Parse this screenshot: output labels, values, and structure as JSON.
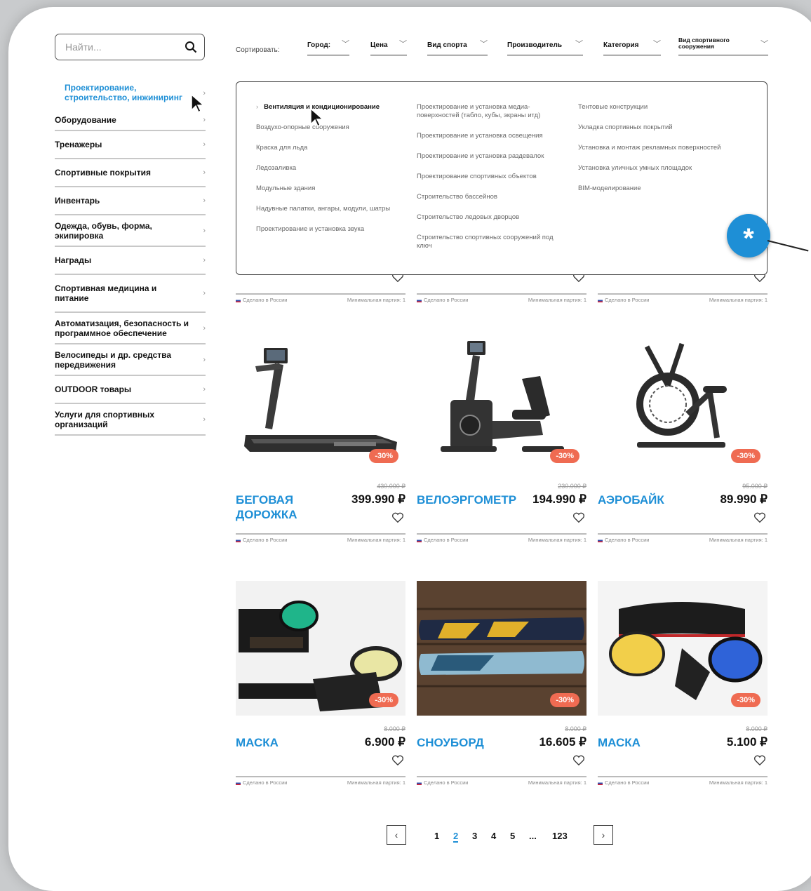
{
  "search": {
    "placeholder": "Найти..."
  },
  "sidebar": {
    "items": [
      {
        "label": "Проектирование, строительство, инжиниринг",
        "active": true
      },
      {
        "label": "Оборудование"
      },
      {
        "label": "Тренажеры"
      },
      {
        "label": "Спортивные покрытия"
      },
      {
        "label": "Инвентарь"
      },
      {
        "label": "Одежда, обувь, форма, экипировка"
      },
      {
        "label": "Награды"
      },
      {
        "label": "Спортивная медицина и питание"
      },
      {
        "label": "Автоматизация, безопасность и программное обеспечение"
      },
      {
        "label": "Велосипеды и др. средства передвижения"
      },
      {
        "label": "OUTDOOR товары"
      },
      {
        "label": "Услуги для спортивных организаций"
      }
    ]
  },
  "sort": {
    "label": "Сортировать:",
    "filters": [
      "Город:",
      "Цена",
      "Вид спорта",
      "Производитель",
      "Категория",
      "Вид спортивного сооружения"
    ]
  },
  "dropdown": {
    "col1": [
      "Вентиляция и кондиционирование",
      "Воздухо-опорные сооружения",
      "Краска для льда",
      "Ледозаливка",
      "Модульные здания",
      "Надувные палатки, ангары, модули, шатры",
      "Проектирование  и установка звука"
    ],
    "col2": [
      "Проектирование и установка медиа-поверхностей (табло, кубы, экраны итд)",
      "Проектирование и установка освещения",
      "Проектирование и установка раздевалок",
      "Проектирование спортивных объектов",
      "Строительство бассейнов",
      "Строительство ледовых дворцов",
      "Строительство спортивных сооружений под ключ"
    ],
    "col3": [
      "Тентовые конструкции",
      "Укладка спортивных покрытий",
      "Установка и монтаж рекламных поверхностей",
      "Установка уличных умных площадок",
      "BIM-моделирование"
    ]
  },
  "badge": {
    "symbol": "*"
  },
  "meta": {
    "made": "Сделано в России",
    "min": "Минимальная партия: 1"
  },
  "products": [
    {
      "name": "БЕГОВАЯ ДОРОЖКА",
      "old": "430.000 ₽",
      "price": "399.990 ₽",
      "discount": "-30%",
      "icon": "treadmill-icon"
    },
    {
      "name": "ВЕЛОЭРГОМЕТР",
      "old": "230.000 ₽",
      "price": "194.990 ₽",
      "discount": "-30%",
      "icon": "exercise-bike-icon"
    },
    {
      "name": "АЭРОБАЙК",
      "old": "95.000 ₽",
      "price": "89.990 ₽",
      "discount": "-30%",
      "icon": "air-bike-icon"
    },
    {
      "name": "МАСКА",
      "old": "8.000 ₽",
      "price": "6.900 ₽",
      "discount": "-30%",
      "icon": "goggles-icon"
    },
    {
      "name": "СНОУБОРД",
      "old": "8.000 ₽",
      "price": "16.605 ₽",
      "discount": "-30%",
      "icon": "snowboard-icon"
    },
    {
      "name": "МАСКА",
      "old": "8.000 ₽",
      "price": "5.100 ₽",
      "discount": "-30%",
      "icon": "goggles-icon"
    }
  ],
  "pagination": {
    "pages": [
      "1",
      "2",
      "3",
      "4",
      "5",
      "...",
      "123"
    ],
    "current": "2",
    "prev": "‹",
    "next": "›"
  }
}
